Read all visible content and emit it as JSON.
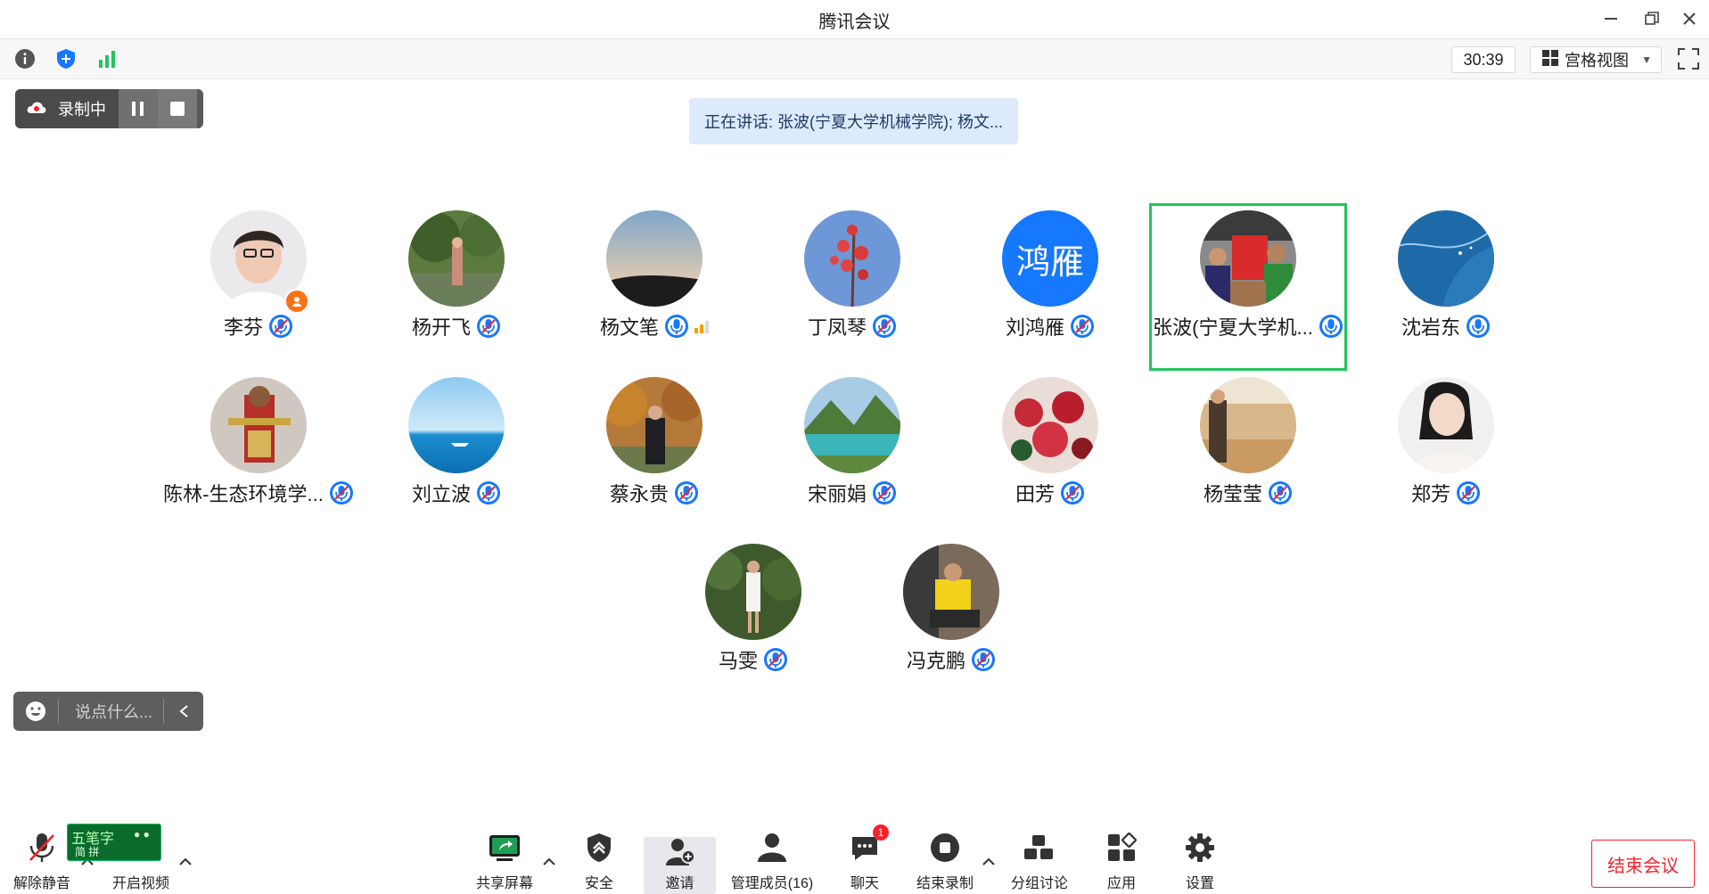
{
  "window": {
    "title": "腾讯会议"
  },
  "toolbar": {
    "timer": "30:39",
    "view_label": "宫格视图"
  },
  "recording": {
    "label": "录制中"
  },
  "speaking_banner": "正在讲话: 张波(宁夏大学机械学院); 杨文...",
  "participants": [
    {
      "name": "李芬"
    },
    {
      "name": "杨开飞"
    },
    {
      "name": "杨文笔"
    },
    {
      "name": "丁凤琴"
    },
    {
      "name": "刘鸿雁",
      "avatar_text": "鸿雁"
    },
    {
      "name": "张波(宁夏大学机..."
    },
    {
      "name": "沈岩东"
    },
    {
      "name": "陈林-生态环境学..."
    },
    {
      "name": "刘立波"
    },
    {
      "name": "蔡永贵"
    },
    {
      "name": "宋丽娟"
    },
    {
      "name": "田芳"
    },
    {
      "name": "杨莹莹"
    },
    {
      "name": "郑芳"
    },
    {
      "name": "马雯"
    },
    {
      "name": "冯克鹏"
    }
  ],
  "chat": {
    "placeholder": "说点什么..."
  },
  "ime": {
    "line1": "五笔字",
    "line2": "简 拼"
  },
  "bottom_bar": {
    "unmute": "解除静音",
    "start_video": "开启视频",
    "share_screen": "共享屏幕",
    "security": "安全",
    "invite": "邀请",
    "manage_members": "管理成员(16)",
    "chat": "聊天",
    "chat_badge": "1",
    "end_recording": "结束录制",
    "breakout": "分组讨论",
    "apps": "应用",
    "settings": "设置",
    "end_meeting": "结束会议"
  },
  "colors": {
    "accent": "#1677ff",
    "active_border": "#22c55e",
    "danger": "#f5222d",
    "signal_good": "#22c55e"
  }
}
